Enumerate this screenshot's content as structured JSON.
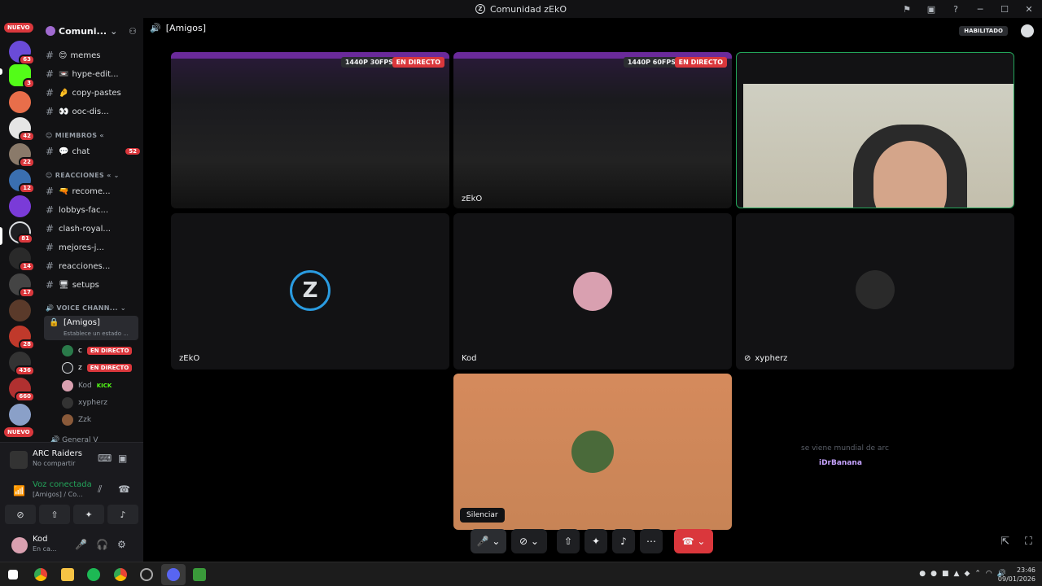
{
  "window": {
    "title": "Comunidad zEkO"
  },
  "titlebar_icons": [
    "inbox-icon",
    "monitor-icon",
    "help-icon",
    "minimize-icon",
    "maximize-icon",
    "close-icon"
  ],
  "servers": {
    "new_label_top": "NUEVO",
    "new_label_bottom": "NUEVO",
    "badges": [
      "63",
      "3",
      "42",
      "22",
      "12",
      "81",
      "14",
      "17",
      "28",
      "436",
      "660"
    ]
  },
  "sidebar": {
    "server_name": "Comuni...",
    "channels": [
      {
        "emoji": "😊",
        "label": "memes"
      },
      {
        "emoji": "📼",
        "label": "hype-edit..."
      },
      {
        "emoji": "🤌",
        "label": "copy-pastes"
      },
      {
        "emoji": "👀",
        "label": "ooc-dis..."
      }
    ],
    "cat_members": "MIEMBROS",
    "chat": {
      "emoji": "💬",
      "label": "chat",
      "count": "52"
    },
    "cat_reactions": "REACCIONES",
    "reaction_channels": [
      {
        "emoji": "🔫",
        "label": "recome..."
      },
      {
        "emoji": "",
        "label": "lobbys-fac..."
      },
      {
        "emoji": "",
        "label": "clash-royal..."
      },
      {
        "emoji": "",
        "label": "mejores-j..."
      },
      {
        "emoji": "",
        "label": "reacciones..."
      },
      {
        "emoji": "🖥",
        "label": "setups"
      }
    ],
    "cat_voice": "VOICE CHANN...",
    "voice_channel": {
      "label": "[Amigos]",
      "status": "Establece un estado ..."
    },
    "voice_users": [
      {
        "name": "c",
        "live": "EN DIRECTO"
      },
      {
        "name": "z",
        "live": "EN DIRECTO"
      },
      {
        "name": "Kod",
        "extra": "KICK"
      },
      {
        "name": "xypherz",
        "extra": ""
      },
      {
        "name": "Zzk",
        "extra": ""
      }
    ],
    "next_channel": "General V"
  },
  "user_panel": {
    "activity_title": "ARC Raiders",
    "activity_sub": "No compartir",
    "voice_status": "Voz conectada",
    "voice_channel": "[Amigos] / Co...",
    "username": "Kod",
    "user_status": "En ca..."
  },
  "main": {
    "channel_title": "[Amigos]",
    "enabled_label": "HABILITADO",
    "tiles": [
      {
        "name": "",
        "quality": "1440P 30FPS",
        "live": "EN DIRECTO"
      },
      {
        "name": "zEkO",
        "quality": "1440P 60FPS",
        "live": "EN DIRECTO"
      },
      {
        "name": "zEkO"
      },
      {
        "name": "Kod"
      },
      {
        "name": "xypherz"
      }
    ],
    "overlay_chat": {
      "message": "se viene mundial de arc",
      "user": "iDrBanana"
    },
    "tooltip": "Silenciar"
  },
  "taskbar": {
    "time": "23:46",
    "date": "09/01/2026"
  },
  "colors": {
    "accent_red": "#da373c",
    "live_red": "#da373c",
    "green": "#23a55a",
    "bg": "#000000",
    "orange_tile": "#d58a5c"
  }
}
